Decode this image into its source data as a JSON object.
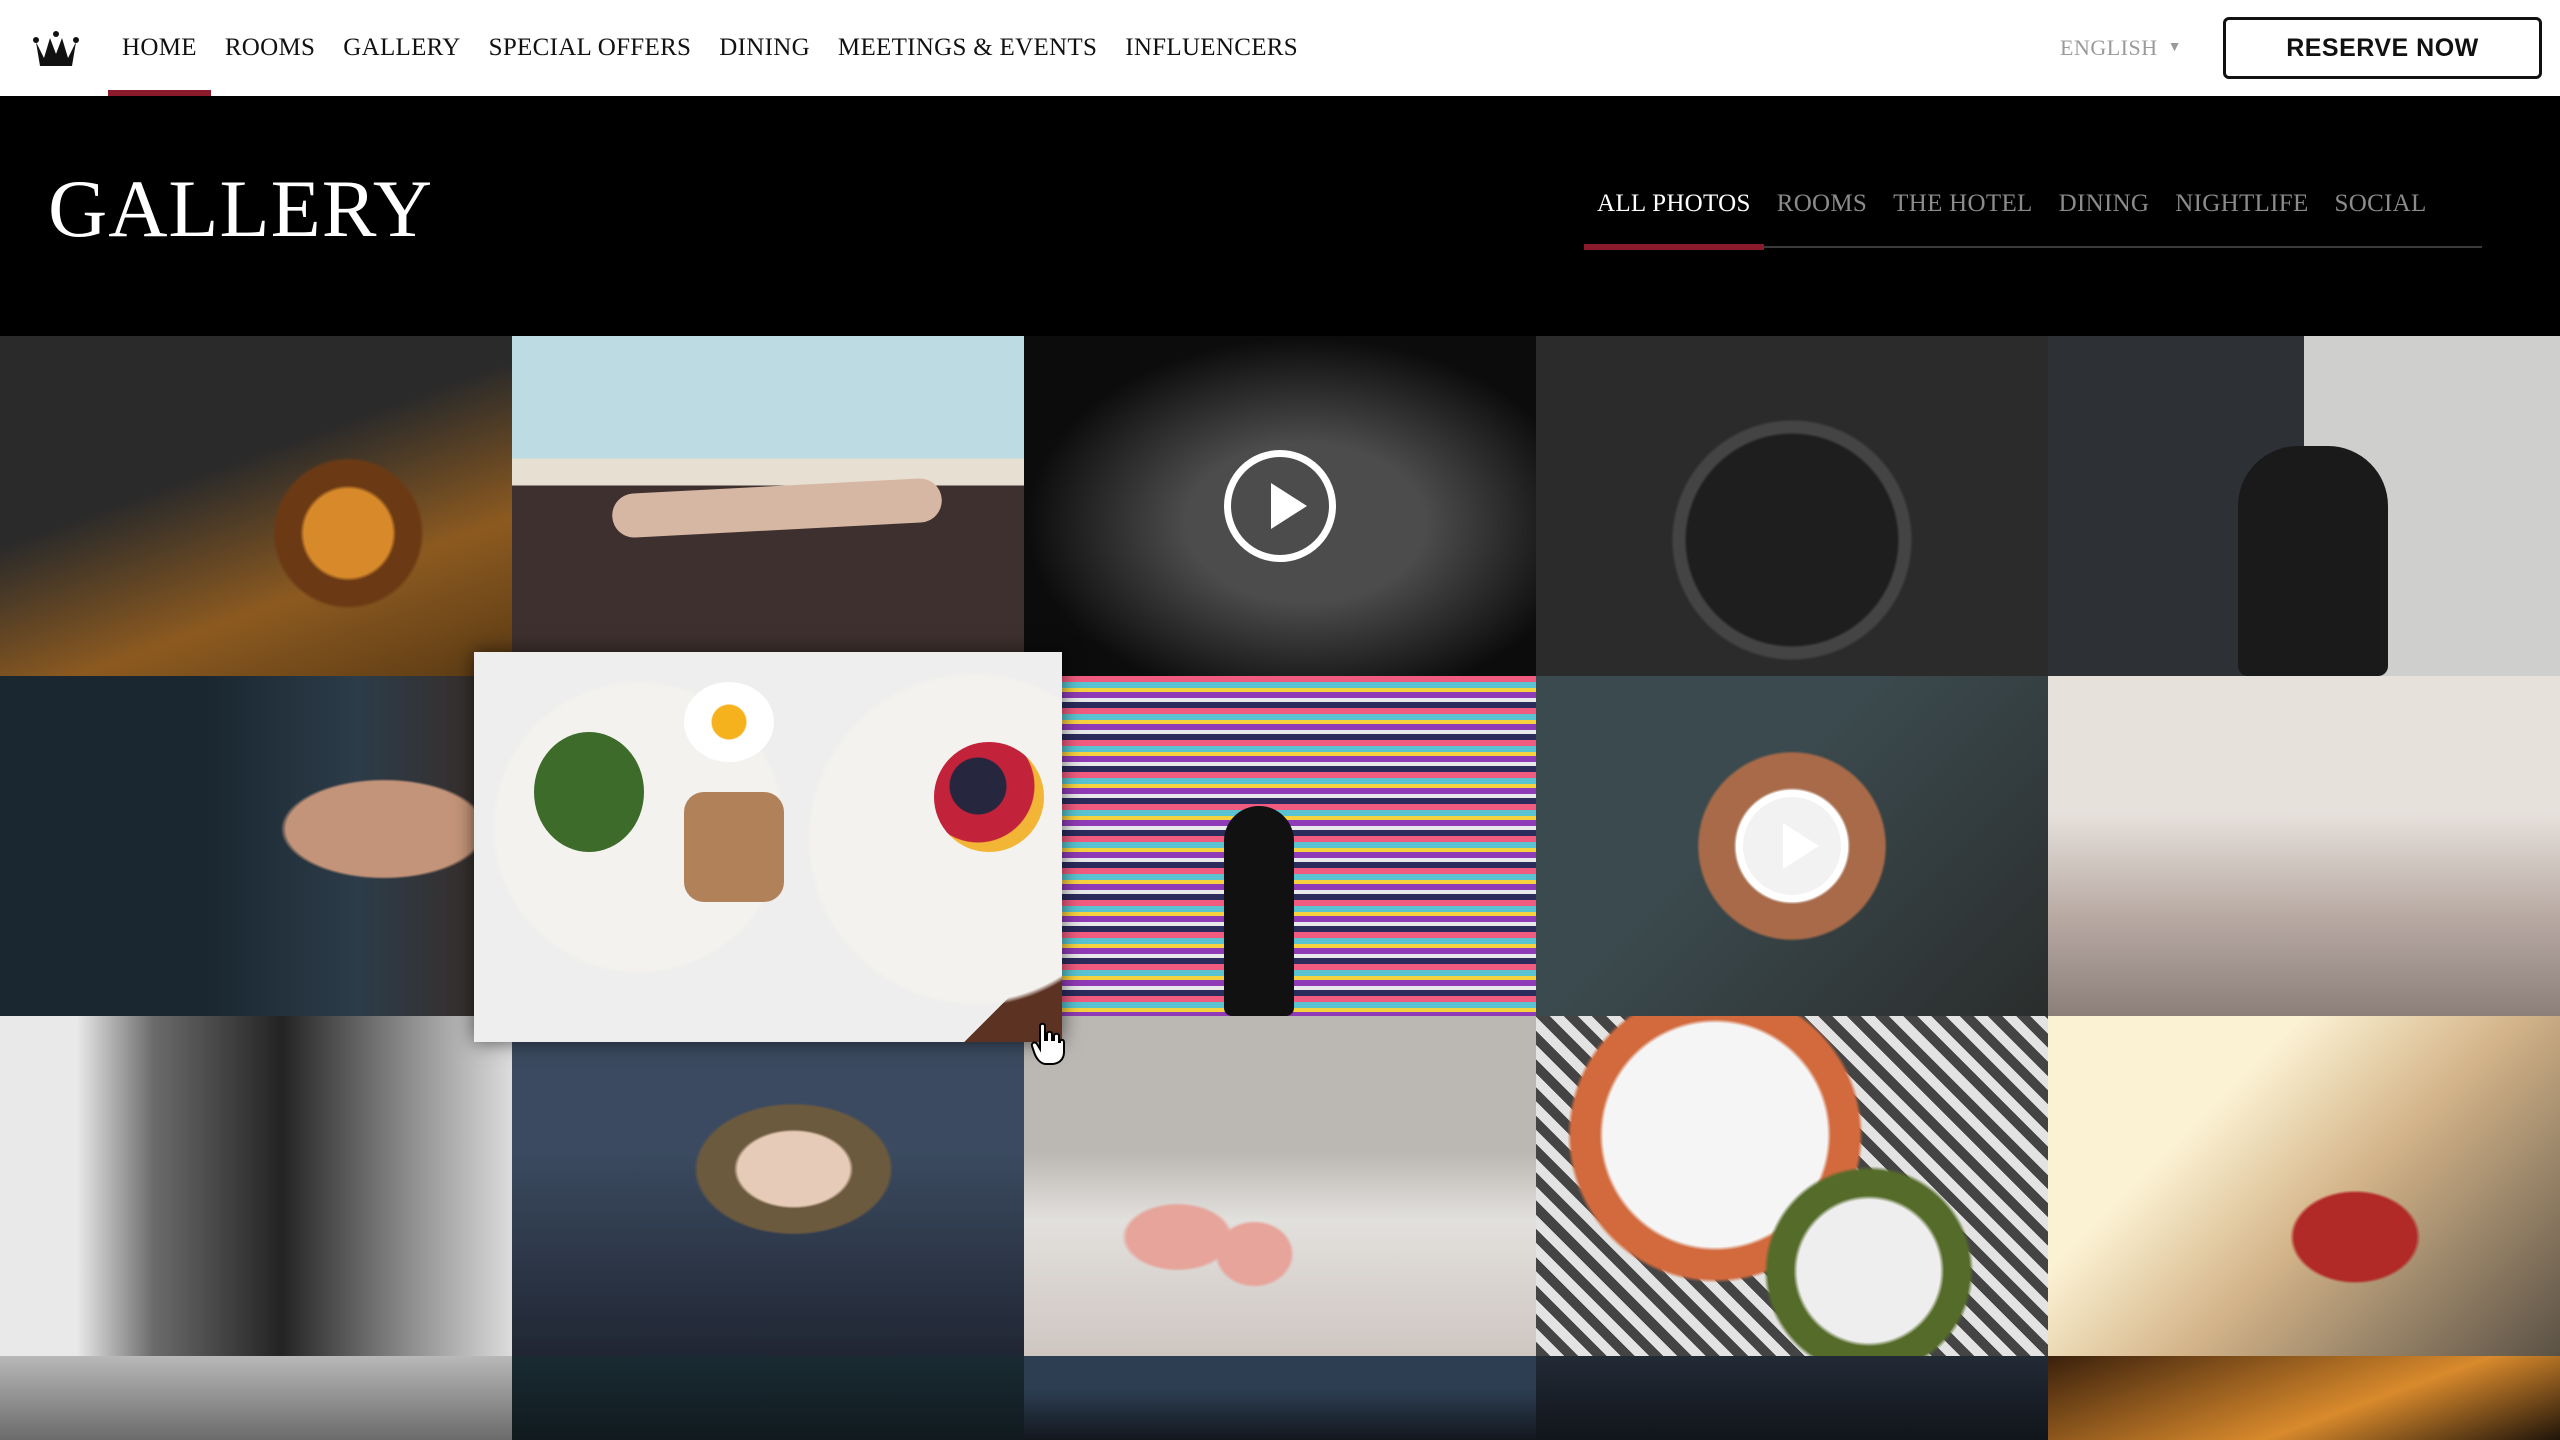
{
  "nav": {
    "logo": "crown-logo",
    "links": [
      "HOME",
      "ROOMS",
      "GALLERY",
      "SPECIAL OFFERS",
      "DINING",
      "MEETINGS & EVENTS",
      "INFLUENCERS"
    ],
    "active": "HOME",
    "language": "ENGLISH",
    "reserve_label": "RESERVE NOW"
  },
  "header": {
    "title": "GALLERY",
    "filters": [
      "ALL PHOTOS",
      "ROOMS",
      "THE HOTEL",
      "DINING",
      "NIGHTLIFE",
      "SOCIAL"
    ],
    "active_filter": "ALL PHOTOS"
  },
  "gallery": {
    "tiles": [
      {
        "subject": "whiskey-pour-photo",
        "video": false
      },
      {
        "subject": "poolside-lounging-photo",
        "video": false
      },
      {
        "subject": "piano-hands-video",
        "video": true
      },
      {
        "subject": "chocolate-plate-photo",
        "video": false
      },
      {
        "subject": "man-in-hat-photo",
        "video": false
      },
      {
        "subject": "woman-portrait-photo",
        "video": false
      },
      {
        "subject": "breakfast-tray-photo",
        "video": false,
        "hovered": true
      },
      {
        "subject": "striped-wall-photo",
        "video": false
      },
      {
        "subject": "dessert-glass-video",
        "video": true
      },
      {
        "subject": "bed-relaxing-photo",
        "video": false
      },
      {
        "subject": "leather-jacket-phone-photo",
        "video": false
      },
      {
        "subject": "fur-coat-model-photo",
        "video": false
      },
      {
        "subject": "cocktail-bar-photo",
        "video": false
      },
      {
        "subject": "seafood-platter-photo",
        "video": false
      },
      {
        "subject": "man-on-pier-photo",
        "video": false
      },
      {
        "subject": "shoes-photo",
        "video": false
      },
      {
        "subject": "magazine-photo",
        "video": false
      },
      {
        "subject": "city-night-photo",
        "video": false
      },
      {
        "subject": "tower-night-photo",
        "video": false
      },
      {
        "subject": "amber-light-photo",
        "video": false
      }
    ]
  },
  "colors": {
    "accent": "#8a1a2c",
    "nav_bg": "#ffffff",
    "band_bg": "#000000",
    "inactive_filter": "#8b8b8b"
  }
}
